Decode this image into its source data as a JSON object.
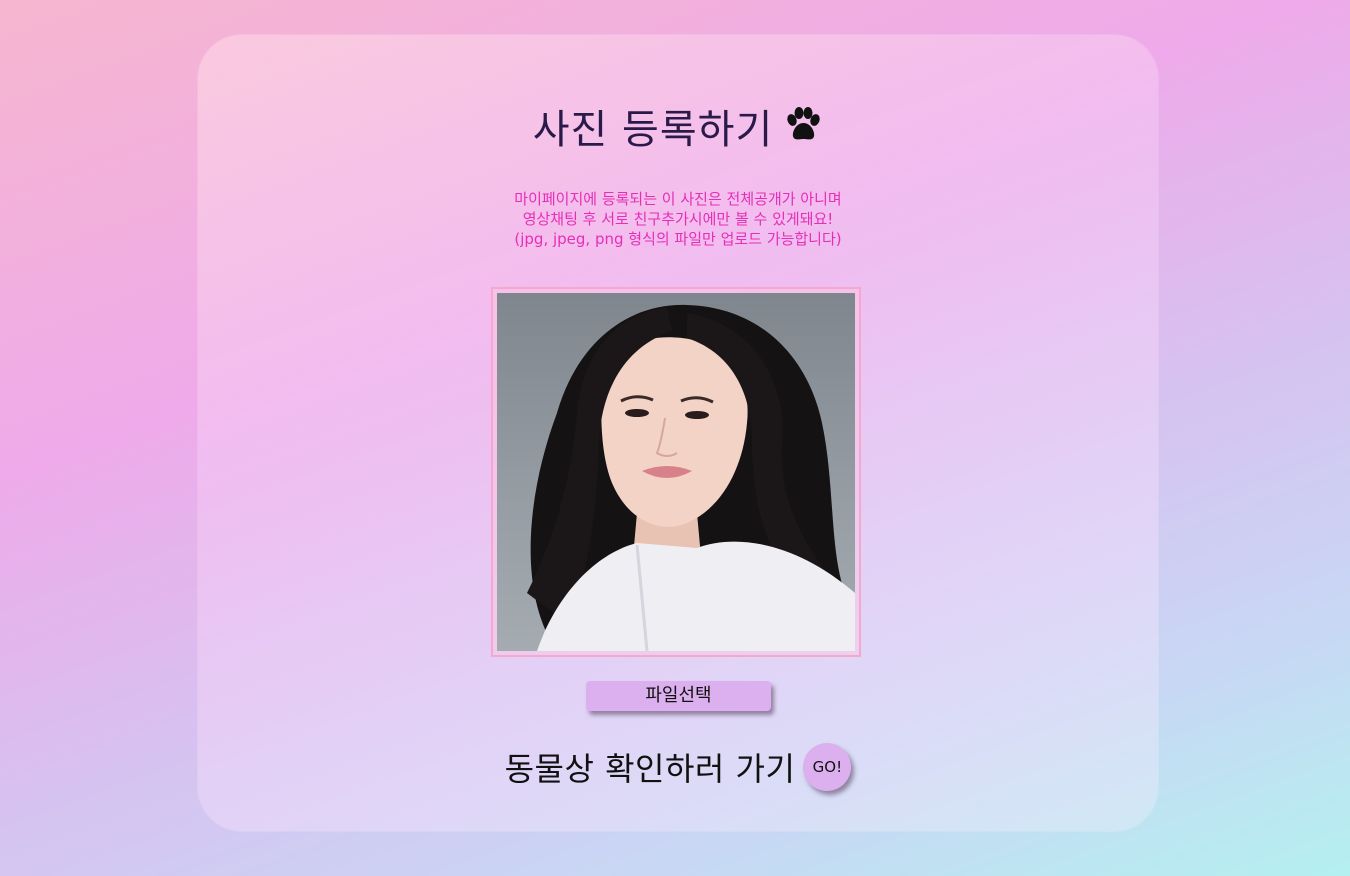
{
  "page": {
    "title": "사진 등록하기",
    "title_icon": "paw-icon",
    "description_lines": [
      "마이페이지에 등록되는 이 사진은 전체공개가 아니며",
      "영상채팅 후 서로 친구추가시에만 볼 수 있게돼요!",
      "(jpg, jpeg, png 형식의 파일만 업로드 가능합니다)"
    ],
    "file_button_label": "파일선택",
    "go_text": "동물상 확인하러 가기",
    "go_button_label": "GO!"
  },
  "colors": {
    "accent": "#dcb0ef",
    "description": "#e62fb5",
    "title": "#2a1a4a",
    "frame_border": "#f5a8cc"
  }
}
